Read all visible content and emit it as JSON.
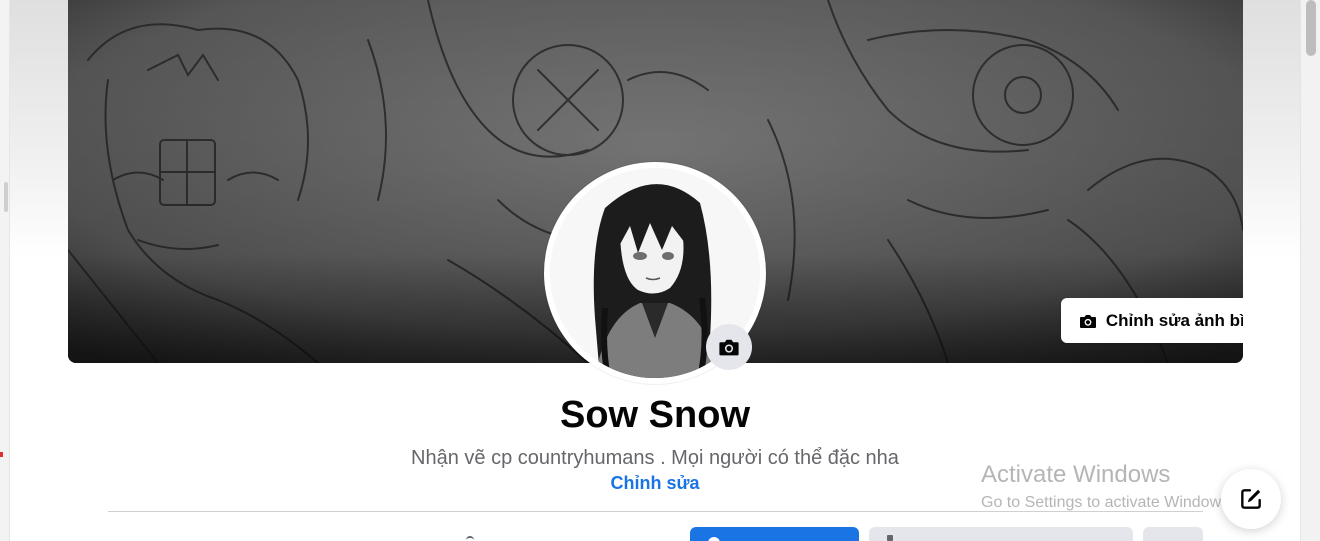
{
  "profile": {
    "name": "Sow Snow",
    "bio": "Nhận vẽ cp countryhumans . Mọi người có thể đặc nha",
    "edit_bio_label": "Chỉnh sửa"
  },
  "cover": {
    "edit_label": "Chỉnh sửa ảnh bìa"
  },
  "watermark": {
    "title": "Activate Windows",
    "subtitle": "Go to Settings to activate Windows."
  },
  "icons": {
    "cover_camera": "camera-icon",
    "avatar_camera": "camera-icon",
    "compose": "compose-message-icon"
  },
  "colors": {
    "primary": "#1b74e4",
    "secondary_button": "#e4e6eb",
    "text_primary": "#050505",
    "text_secondary": "#65676b"
  }
}
